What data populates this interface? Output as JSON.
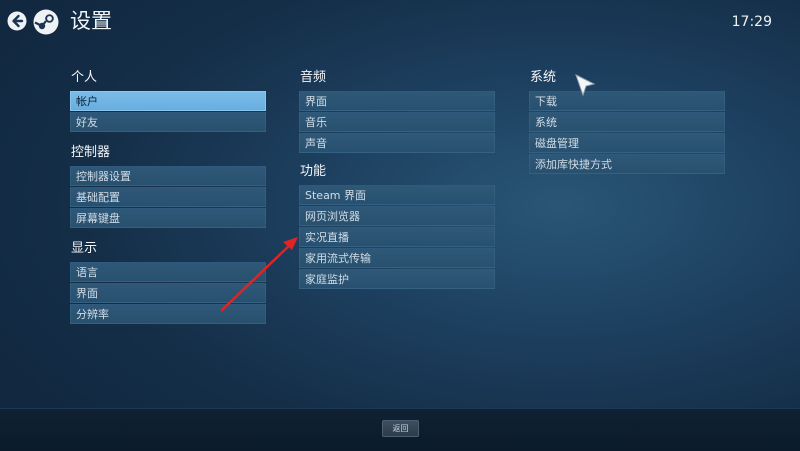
{
  "header": {
    "title": "设置",
    "clock": "17:29",
    "back_icon": "back-arrow-icon",
    "logo_icon": "steam-logo-icon"
  },
  "columns": {
    "personal": {
      "title": "个人",
      "items": [
        {
          "label": "帐户",
          "selected": true
        },
        {
          "label": "好友",
          "selected": false
        }
      ]
    },
    "controller": {
      "title": "控制器",
      "items": [
        {
          "label": "控制器设置"
        },
        {
          "label": "基础配置"
        },
        {
          "label": "屏幕键盘"
        }
      ]
    },
    "display": {
      "title": "显示",
      "items": [
        {
          "label": "语言"
        },
        {
          "label": "界面"
        },
        {
          "label": "分辨率"
        }
      ]
    },
    "audio": {
      "title": "音频",
      "items": [
        {
          "label": "界面"
        },
        {
          "label": "音乐"
        },
        {
          "label": "声音"
        }
      ]
    },
    "features": {
      "title": "功能",
      "items": [
        {
          "label": "Steam 界面"
        },
        {
          "label": "网页浏览器"
        },
        {
          "label": "实况直播"
        },
        {
          "label": "家用流式传输"
        },
        {
          "label": "家庭监护"
        }
      ]
    },
    "system": {
      "title": "系统",
      "items": [
        {
          "label": "下载"
        },
        {
          "label": "系统"
        },
        {
          "label": "磁盘管理"
        },
        {
          "label": "添加库快捷方式"
        }
      ]
    }
  },
  "footer": {
    "back_label": "返回"
  },
  "colors": {
    "selected_item": "#6fb4e3",
    "item_bg": "#2c5474",
    "annotation_arrow": "#e02424"
  }
}
